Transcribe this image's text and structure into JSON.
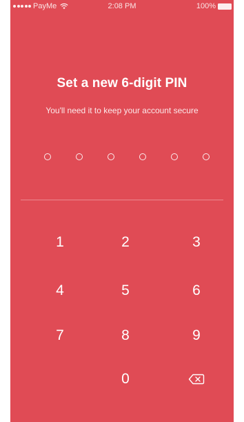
{
  "status_bar": {
    "carrier": "PayMe",
    "time": "2:08 PM",
    "battery": "100%"
  },
  "title": "Set a new 6-digit PIN",
  "subtitle": "You'll need it to keep your account secure",
  "pin": {
    "length": 6,
    "filled": 0
  },
  "keypad": {
    "keys": [
      "1",
      "2",
      "3",
      "4",
      "5",
      "6",
      "7",
      "8",
      "9",
      "0"
    ],
    "backspace_icon": "backspace-icon"
  },
  "colors": {
    "background": "#e04b55",
    "foreground": "#ffffff"
  }
}
